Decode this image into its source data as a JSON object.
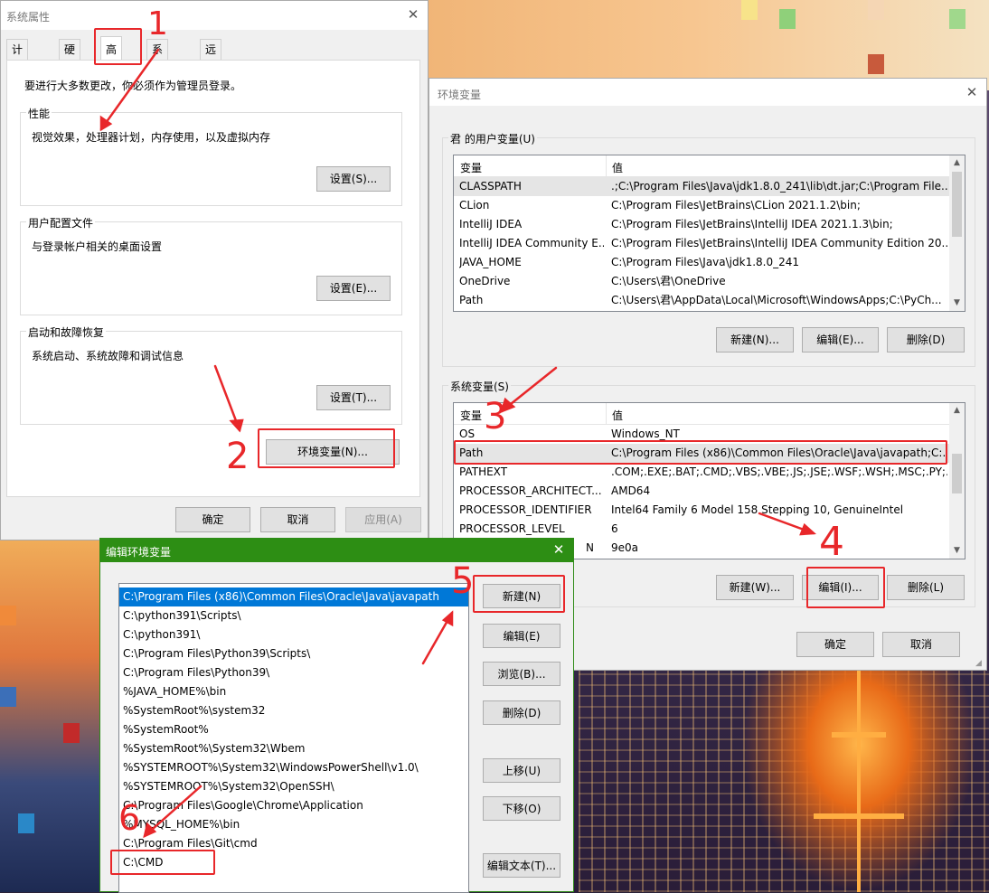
{
  "system_properties": {
    "title": "系统属性",
    "close": "✕",
    "tabs": [
      "计算机名",
      "硬件",
      "高级",
      "系统保护",
      "远程"
    ],
    "admin_note": "要进行大多数更改，你必须作为管理员登录。",
    "groups": [
      {
        "label": "性能",
        "desc": "视觉效果，处理器计划，内存使用，以及虚拟内存",
        "button": "设置(S)..."
      },
      {
        "label": "用户配置文件",
        "desc": "与登录帐户相关的桌面设置",
        "button": "设置(E)..."
      },
      {
        "label": "启动和故障恢复",
        "desc": "系统启动、系统故障和调试信息",
        "button": "设置(T)..."
      }
    ],
    "env_button": "环境变量(N)...",
    "ok": "确定",
    "cancel": "取消",
    "apply": "应用(A)"
  },
  "env_vars": {
    "title": "环境变量",
    "close": "✕",
    "user_section": "君 的用户变量(U)",
    "system_section": "系统变量(S)",
    "col_var": "变量",
    "col_val": "值",
    "user_vars": [
      {
        "name": "CLASSPATH",
        "value": ".;C:\\Program Files\\Java\\jdk1.8.0_241\\lib\\dt.jar;C:\\Program File..."
      },
      {
        "name": "CLion",
        "value": "C:\\Program Files\\JetBrains\\CLion 2021.1.2\\bin;"
      },
      {
        "name": "IntelliJ IDEA",
        "value": "C:\\Program Files\\JetBrains\\IntelliJ IDEA 2021.1.3\\bin;"
      },
      {
        "name": "IntelliJ IDEA Community E...",
        "value": "C:\\Program Files\\JetBrains\\IntelliJ IDEA Community Edition 20..."
      },
      {
        "name": "JAVA_HOME",
        "value": "C:\\Program Files\\Java\\jdk1.8.0_241"
      },
      {
        "name": "OneDrive",
        "value": "C:\\Users\\君\\OneDrive"
      },
      {
        "name": "Path",
        "value": "C:\\Users\\君\\AppData\\Local\\Microsoft\\WindowsApps;C:\\PyCh..."
      }
    ],
    "user_buttons": [
      "新建(N)...",
      "编辑(E)...",
      "删除(D)"
    ],
    "system_vars": [
      {
        "name": "OS",
        "value": "Windows_NT"
      },
      {
        "name": "Path",
        "value": "C:\\Program Files (x86)\\Common Files\\Oracle\\Java\\javapath;C:..."
      },
      {
        "name": "PATHEXT",
        "value": ".COM;.EXE;.BAT;.CMD;.VBS;.VBE;.JS;.JSE;.WSF;.WSH;.MSC;.PY;.P..."
      },
      {
        "name": "PROCESSOR_ARCHITECT...",
        "value": "AMD64"
      },
      {
        "name": "PROCESSOR_IDENTIFIER",
        "value": "Intel64 Family 6 Model 158 Stepping 10, GenuineIntel"
      },
      {
        "name": "PROCESSOR_LEVEL",
        "value": "6"
      },
      {
        "name": "N",
        "value": "9e0a"
      }
    ],
    "system_buttons": [
      "新建(W)...",
      "编辑(I)...",
      "删除(L)"
    ],
    "ok": "确定",
    "cancel": "取消"
  },
  "edit_env": {
    "title": "编辑环境变量",
    "close": "✕",
    "paths": [
      "C:\\Program Files (x86)\\Common Files\\Oracle\\Java\\javapath",
      "C:\\python391\\Scripts\\",
      "C:\\python391\\",
      "C:\\Program Files\\Python39\\Scripts\\",
      "C:\\Program Files\\Python39\\",
      "%JAVA_HOME%\\bin",
      "%SystemRoot%\\system32",
      "%SystemRoot%",
      "%SystemRoot%\\System32\\Wbem",
      "%SYSTEMROOT%\\System32\\WindowsPowerShell\\v1.0\\",
      "%SYSTEMROOT%\\System32\\OpenSSH\\",
      "C:\\Program Files\\Google\\Chrome\\Application",
      "%MYSQL_HOME%\\bin",
      "C:\\Program Files\\Git\\cmd",
      "C:\\CMD"
    ],
    "buttons": [
      "新建(N)",
      "编辑(E)",
      "浏览(B)...",
      "删除(D)",
      "上移(U)",
      "下移(O)",
      "编辑文本(T)..."
    ]
  },
  "annotations": [
    "1",
    "2",
    "3",
    "4",
    "5",
    "6"
  ],
  "colors": {
    "annotation": "#e8272a",
    "edit_title": "#2d8e14",
    "selection": "#0078d7"
  }
}
